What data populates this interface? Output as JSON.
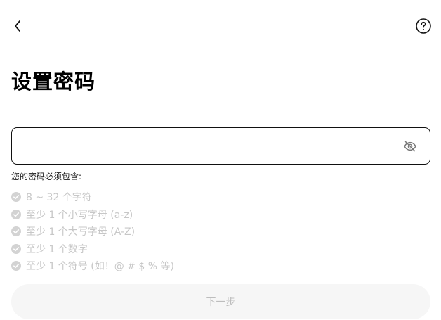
{
  "header": {
    "back_icon": "chevron-left-icon",
    "help_icon": "question-circle-icon"
  },
  "title": "设置密码",
  "password": {
    "value": "",
    "placeholder": "",
    "toggle_icon": "eye-off-icon"
  },
  "requirements": {
    "heading": "您的密码必须包含:",
    "items": [
      {
        "label": "8 ~ 32 个字符",
        "satisfied": false
      },
      {
        "label": "至少 1 个小写字母 (a-z)",
        "satisfied": false
      },
      {
        "label": "至少 1 个大写字母 (A-Z)",
        "satisfied": false
      },
      {
        "label": "至少 1 个数字",
        "satisfied": false
      },
      {
        "label": "至少 1 个符号 (如！@ # $ % 等)",
        "satisfied": false
      }
    ]
  },
  "next_button": {
    "label": "下一步",
    "enabled": false
  },
  "colors": {
    "text_primary": "#000000",
    "text_disabled": "#c7c7c7",
    "button_disabled_bg": "#f6f6f6",
    "input_border": "#111111"
  }
}
